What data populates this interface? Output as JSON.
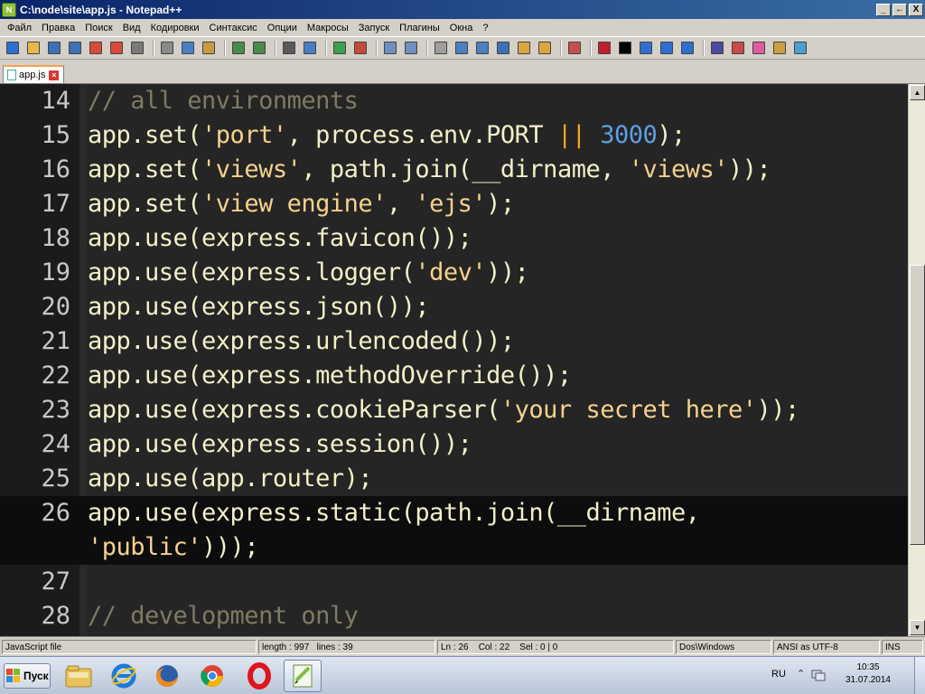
{
  "window": {
    "title": "C:\\node\\site\\app.js - Notepad++",
    "controls": [
      "_",
      "←",
      "X"
    ]
  },
  "menu": [
    "Файл",
    "Правка",
    "Поиск",
    "Вид",
    "Кодировки",
    "Синтаксис",
    "Опции",
    "Макросы",
    "Запуск",
    "Плагины",
    "Окна",
    "?"
  ],
  "toolbar": {
    "icons": [
      "new-file",
      "open-file",
      "save",
      "save-all",
      "close",
      "close-all",
      "print",
      "cut",
      "copy",
      "paste",
      "undo",
      "redo",
      "find",
      "replace",
      "zoom-in",
      "zoom-out",
      "sync-vertical",
      "sync-horizontal",
      "word-wrap",
      "show-all-chars",
      "indent-guide",
      "user-defined-language",
      "doc-map",
      "function-list",
      "folder-as-workspace",
      "record-macro",
      "stop-macro",
      "play-macro",
      "run-macro-multiple",
      "save-macro",
      "spellcheck",
      "spellcheck-options",
      "favorite",
      "plugin-a",
      "plugin-b"
    ],
    "colors": [
      "#2f6fd1",
      "#e8b84a",
      "#3f6fb5",
      "#3f6fb5",
      "#d84a3a",
      "#d84a3a",
      "#7a7a7a",
      "#8a8a8a",
      "#4a7fc1",
      "#c99b3f",
      "#4a8a4a",
      "#4a8a4a",
      "#5a5a5a",
      "#4b7ec4",
      "#3f9f4f",
      "#c64a3a",
      "#6f8fbf",
      "#6f8fbf",
      "#9f9f9f",
      "#4a7fc1",
      "#4a7fc1",
      "#3f6fb5",
      "#d9a640",
      "#d9a640",
      "#c44f4f",
      "#c0202a",
      "#000000",
      "#2f6fd1",
      "#2f6fd1",
      "#2f6fd1",
      "#4a4aa0",
      "#c94a4a",
      "#e05aa0",
      "#c9a040",
      "#4a9fd0"
    ]
  },
  "tabs": [
    {
      "label": "app.js",
      "close": "×"
    }
  ],
  "editor": {
    "current_line": 26,
    "lines": [
      {
        "n": "14",
        "tokens": [
          {
            "t": "// all environments",
            "c": "cmt"
          }
        ]
      },
      {
        "n": "15",
        "tokens": [
          {
            "t": "app.set(",
            "c": "ident"
          },
          {
            "t": "'port'",
            "c": "str"
          },
          {
            "t": ", process.env.PORT ",
            "c": "ident"
          },
          {
            "t": "||",
            "c": "op"
          },
          {
            "t": " ",
            "c": "ident"
          },
          {
            "t": "3000",
            "c": "num"
          },
          {
            "t": ");",
            "c": "ident"
          }
        ]
      },
      {
        "n": "16",
        "tokens": [
          {
            "t": "app.set(",
            "c": "ident"
          },
          {
            "t": "'views'",
            "c": "str"
          },
          {
            "t": ", path.join(__dirname, ",
            "c": "ident"
          },
          {
            "t": "'views'",
            "c": "str"
          },
          {
            "t": "));",
            "c": "ident"
          }
        ]
      },
      {
        "n": "17",
        "tokens": [
          {
            "t": "app.set(",
            "c": "ident"
          },
          {
            "t": "'view engine'",
            "c": "str"
          },
          {
            "t": ", ",
            "c": "ident"
          },
          {
            "t": "'ejs'",
            "c": "str"
          },
          {
            "t": ");",
            "c": "ident"
          }
        ]
      },
      {
        "n": "18",
        "tokens": [
          {
            "t": "app.use(express.favicon());",
            "c": "ident"
          }
        ]
      },
      {
        "n": "19",
        "tokens": [
          {
            "t": "app.use(express.logger(",
            "c": "ident"
          },
          {
            "t": "'dev'",
            "c": "str"
          },
          {
            "t": "));",
            "c": "ident"
          }
        ]
      },
      {
        "n": "20",
        "tokens": [
          {
            "t": "app.use(express.json());",
            "c": "ident"
          }
        ]
      },
      {
        "n": "21",
        "tokens": [
          {
            "t": "app.use(express.urlencoded());",
            "c": "ident"
          }
        ]
      },
      {
        "n": "22",
        "tokens": [
          {
            "t": "app.use(express.methodOverride());",
            "c": "ident"
          }
        ]
      },
      {
        "n": "23",
        "tokens": [
          {
            "t": "app.use(express.cookieParser(",
            "c": "ident"
          },
          {
            "t": "'your secret here'",
            "c": "str"
          },
          {
            "t": "));",
            "c": "ident"
          }
        ]
      },
      {
        "n": "24",
        "tokens": [
          {
            "t": "app.use(express.session());",
            "c": "ident"
          }
        ]
      },
      {
        "n": "25",
        "tokens": [
          {
            "t": "app.use(app.router);",
            "c": "ident"
          }
        ]
      },
      {
        "n": "26",
        "tokens": [
          {
            "t": "app.use(express.static(path.join(__dirname,",
            "c": "ident"
          }
        ]
      },
      {
        "n": "",
        "tokens": [
          {
            "t": "'public'",
            "c": "str"
          },
          {
            "t": ")));",
            "c": "ident"
          }
        ]
      },
      {
        "n": "27",
        "tokens": []
      },
      {
        "n": "28",
        "tokens": [
          {
            "t": "// development only",
            "c": "cmt"
          }
        ]
      }
    ]
  },
  "statusbar": {
    "file_type": "JavaScript file",
    "length": "length : 997",
    "lines": "lines : 39",
    "position": "Ln : 26    Col : 22    Sel : 0 | 0",
    "eol": "Dos\\Windows",
    "encoding": "ANSI as UTF-8",
    "mode": "INS"
  },
  "taskbar": {
    "start_label": "Пуск",
    "apps": [
      "explorer",
      "internet-explorer",
      "firefox",
      "chrome",
      "opera",
      "notepad-plus-plus"
    ],
    "language": "RU",
    "time": "10:35",
    "date": "31.07.2014"
  }
}
